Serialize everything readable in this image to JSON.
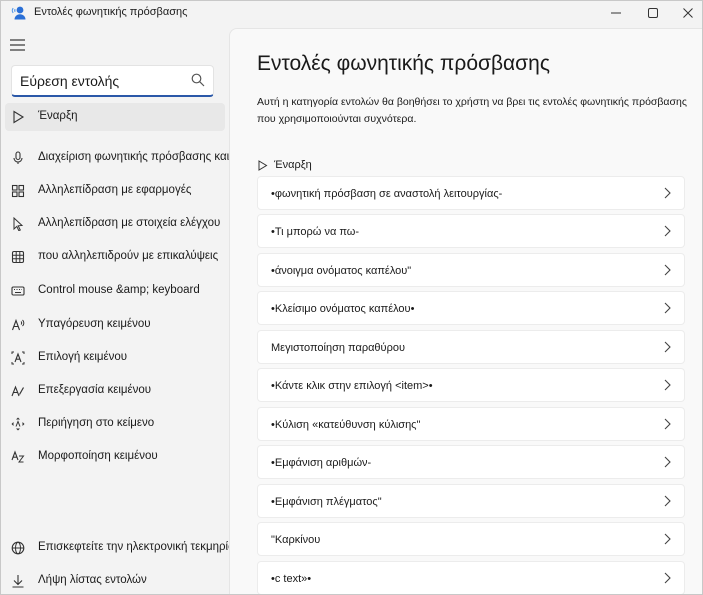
{
  "window": {
    "title": "Εντολές φωνητικής πρόσβασης",
    "accent": "#2b58a8"
  },
  "search": {
    "value": "Εύρεση εντολής",
    "placeholder": "Εύρεση εντολής"
  },
  "sidebar": {
    "items": [
      {
        "label": "Έναρξη",
        "icon": "play-icon",
        "selected": true
      },
      {
        "label": "Διαχείριση φωνητικής πρόσβασης και μικροφώνου",
        "icon": "microphone-icon"
      },
      {
        "label": "Αλληλεπίδραση με εφαρμογές",
        "icon": "apps-icon"
      },
      {
        "label": "Αλληλεπίδραση με στοιχεία ελέγχου",
        "icon": "cursor-icon"
      },
      {
        "label": "που αλληλεπιδρούν με επικαλύψεις",
        "icon": "grid-icon"
      },
      {
        "label": "Control mouse &amp; keyboard",
        "icon": "keyboard-icon"
      },
      {
        "label": "Υπαγόρευση κειμένου",
        "icon": "dictation-icon"
      },
      {
        "label": "Επιλογή κειμένου",
        "icon": "text-select-icon"
      },
      {
        "label": "Επεξεργασία κειμένου",
        "icon": "text-edit-icon"
      },
      {
        "label": "Περιήγηση στο κείμενο",
        "icon": "navigate-icon"
      },
      {
        "label": "Μορφοποίηση κειμένου",
        "icon": "text-format-icon"
      }
    ],
    "footer": [
      {
        "label": "Επισκεφτείτε την ηλεκτρονική τεκμηρίωση",
        "icon": "globe-icon"
      },
      {
        "label": "Λήψη λίστας εντολών",
        "icon": "download-icon"
      }
    ]
  },
  "main": {
    "title": "Εντολές φωνητικής πρόσβασης",
    "description": "Αυτή η κατηγορία εντολών θα βοηθήσει το χρήστη να βρει τις εντολές φωνητικής πρόσβασης που χρησιμοποιούνται συχνότερα.",
    "breadcrumb": "Έναρξη",
    "commands": [
      "•φωνητική πρόσβαση σε αναστολή λειτουργίας-",
      "•Τι μπορώ να πω-",
      "•άνοιγμα ονόματος καπέλου\"",
      "•Κλείσιμο ονόματος καπέλου•",
      "Μεγιστοποίηση παραθύρου",
      "•Κάντε κλικ στην επιλογή <item>•",
      "•Κύλιση «κατεύθυνση κύλισης\"",
      "•Εμφάνιση αριθμών-",
      "•Εμφάνιση πλέγματος\"",
      "\"Καρκίνου",
      "•c text»•"
    ]
  }
}
